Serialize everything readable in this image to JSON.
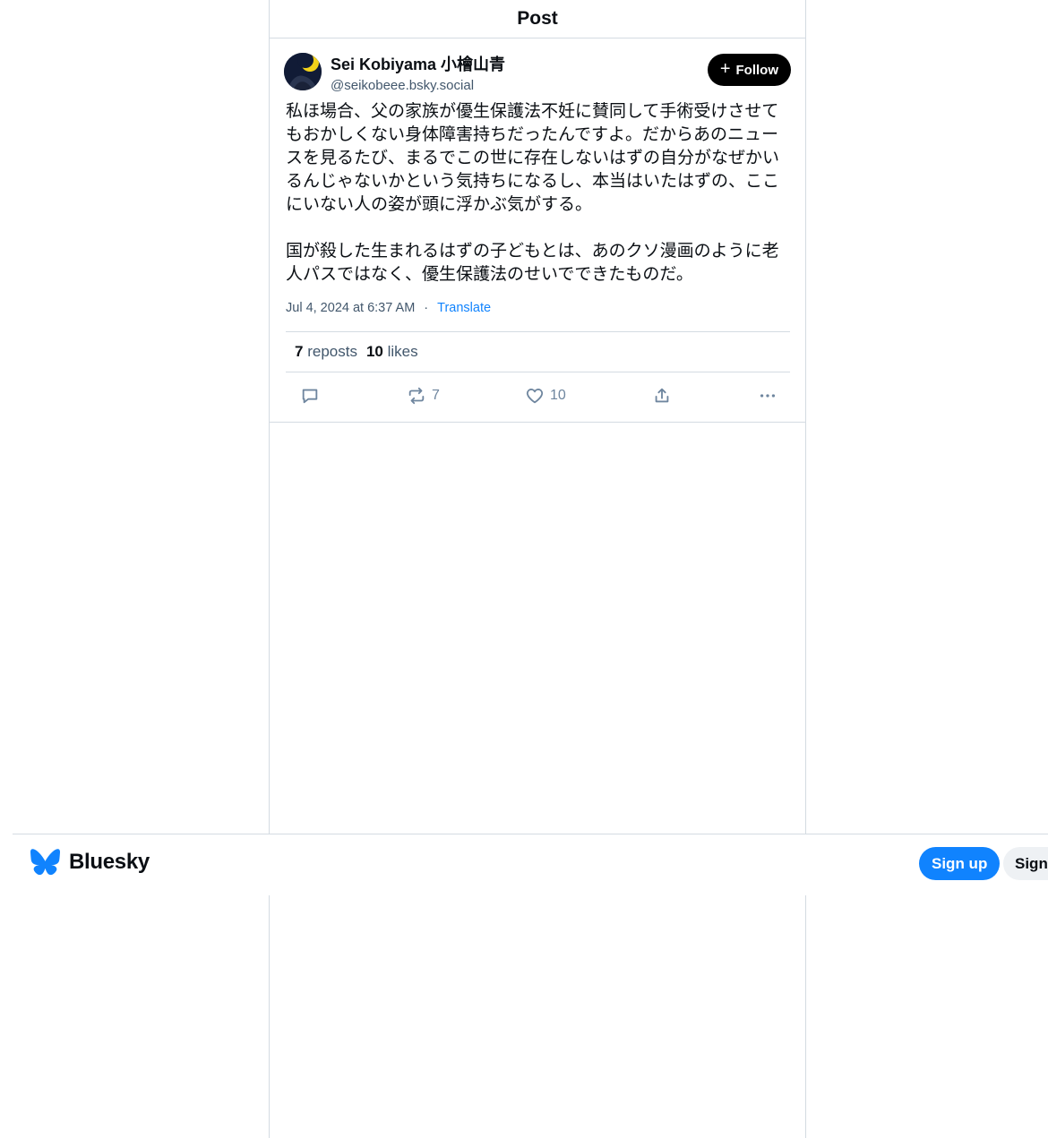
{
  "header": {
    "title": "Post"
  },
  "post": {
    "author": {
      "display_name": "Sei Kobiyama 小檜山青",
      "handle": "@seikobeee.bsky.social",
      "avatar_icon": "avatar-moon-icon"
    },
    "follow_label": "Follow",
    "text": "私ほ場合、父の家族が優生保護法不妊に賛同して手術受けさせてもおかしくない身体障害持ちだったんですよ。だからあのニュースを見るたび、まるでこの世に存在しないはずの自分がなぜかいるんじゃないかという気持ちになるし、本当はいたはずの、ここにいない人の姿が頭に浮かぶ気がする。\n\n国が殺した生まれるはずの子どもとは、あのクソ漫画のように老人パスではなく、優生保護法のせいでできたものだ。",
    "timestamp": "Jul 4, 2024 at 6:37 AM",
    "separator": "·",
    "translate_label": "Translate",
    "reposts_count": "7",
    "reposts_label": "reposts",
    "likes_count": "10",
    "likes_label": "likes",
    "actions": {
      "repost_count": "7",
      "like_count": "10"
    }
  },
  "bottom_bar": {
    "brand": "Bluesky",
    "signup_label": "Sign up",
    "signin_label": "Sign in"
  },
  "colors": {
    "accent": "#1083fe",
    "border": "#d4dbe2",
    "text": "#0b0f14",
    "muted": "#42576c"
  }
}
